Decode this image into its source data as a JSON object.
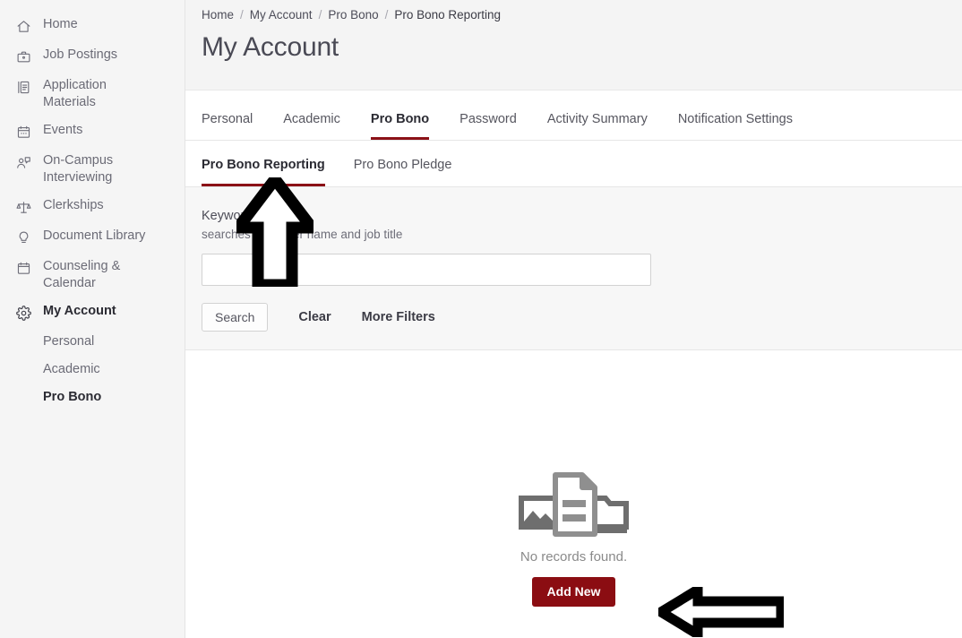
{
  "sidebar": {
    "items": [
      {
        "label": "Home",
        "icon": "home-icon",
        "active": false
      },
      {
        "label": "Job Postings",
        "icon": "briefcase-icon",
        "active": false
      },
      {
        "label": "Application Materials",
        "icon": "document-stack-icon",
        "active": false
      },
      {
        "label": "Events",
        "icon": "calendar-icon",
        "active": false
      },
      {
        "label": "On-Campus Interviewing",
        "icon": "person-speech-icon",
        "active": false
      },
      {
        "label": "Clerkships",
        "icon": "scales-icon",
        "active": false
      },
      {
        "label": "Document Library",
        "icon": "lightbulb-icon",
        "active": false
      },
      {
        "label": "Counseling & Calendar",
        "icon": "calendar-blank-icon",
        "active": false
      },
      {
        "label": "My Account",
        "icon": "gear-icon",
        "active": true
      }
    ],
    "subitems": [
      {
        "label": "Personal",
        "active": false
      },
      {
        "label": "Academic",
        "active": false
      },
      {
        "label": "Pro Bono",
        "active": true
      }
    ]
  },
  "breadcrumb": {
    "separator": "/",
    "items": [
      "Home",
      "My Account",
      "Pro Bono",
      "Pro Bono Reporting"
    ]
  },
  "page": {
    "title": "My Account"
  },
  "tabs_primary": [
    {
      "label": "Personal",
      "active": false
    },
    {
      "label": "Academic",
      "active": false
    },
    {
      "label": "Pro Bono",
      "active": true
    },
    {
      "label": "Password",
      "active": false
    },
    {
      "label": "Activity Summary",
      "active": false
    },
    {
      "label": "Notification Settings",
      "active": false
    }
  ],
  "tabs_secondary": [
    {
      "label": "Pro Bono Reporting",
      "active": true
    },
    {
      "label": "Pro Bono Pledge",
      "active": false
    }
  ],
  "filter": {
    "keyword_label": "Keywords",
    "keyword_hint": "searches employer name and job title",
    "keyword_value": "",
    "keyword_placeholder": "",
    "search_label": "Search",
    "clear_label": "Clear",
    "more_filters_label": "More Filters"
  },
  "empty_state": {
    "message": "No records found.",
    "add_new_label": "Add New",
    "icon": "no-records-icon"
  },
  "annotations": [
    {
      "name": "arrow-up",
      "direction": "up",
      "points_at": "Keywords filter field"
    },
    {
      "name": "arrow-left",
      "direction": "left",
      "points_at": "Add New button"
    }
  ],
  "colors": {
    "accent": "#8b1117",
    "button_primary": "#8b0d12",
    "sidebar_bg": "#f5f5f5",
    "page_bg": "#f4f4f4",
    "panel_bg": "#f7f7f7"
  }
}
